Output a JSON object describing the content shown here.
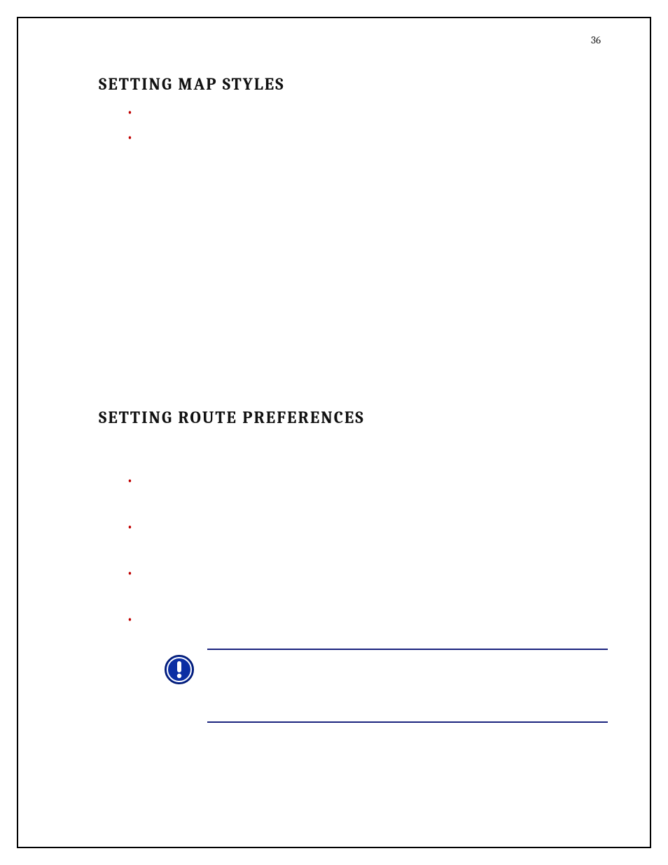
{
  "page_number": "36",
  "sections": {
    "map_styles": {
      "heading": "SETTING MAP STYLES",
      "items": [
        "",
        ""
      ]
    },
    "route_prefs": {
      "heading": "SETTING ROUTE PREFERENCES",
      "items": [
        "",
        "",
        "",
        ""
      ]
    }
  },
  "callout": {
    "icon_name": "notice-icon",
    "text": ""
  }
}
